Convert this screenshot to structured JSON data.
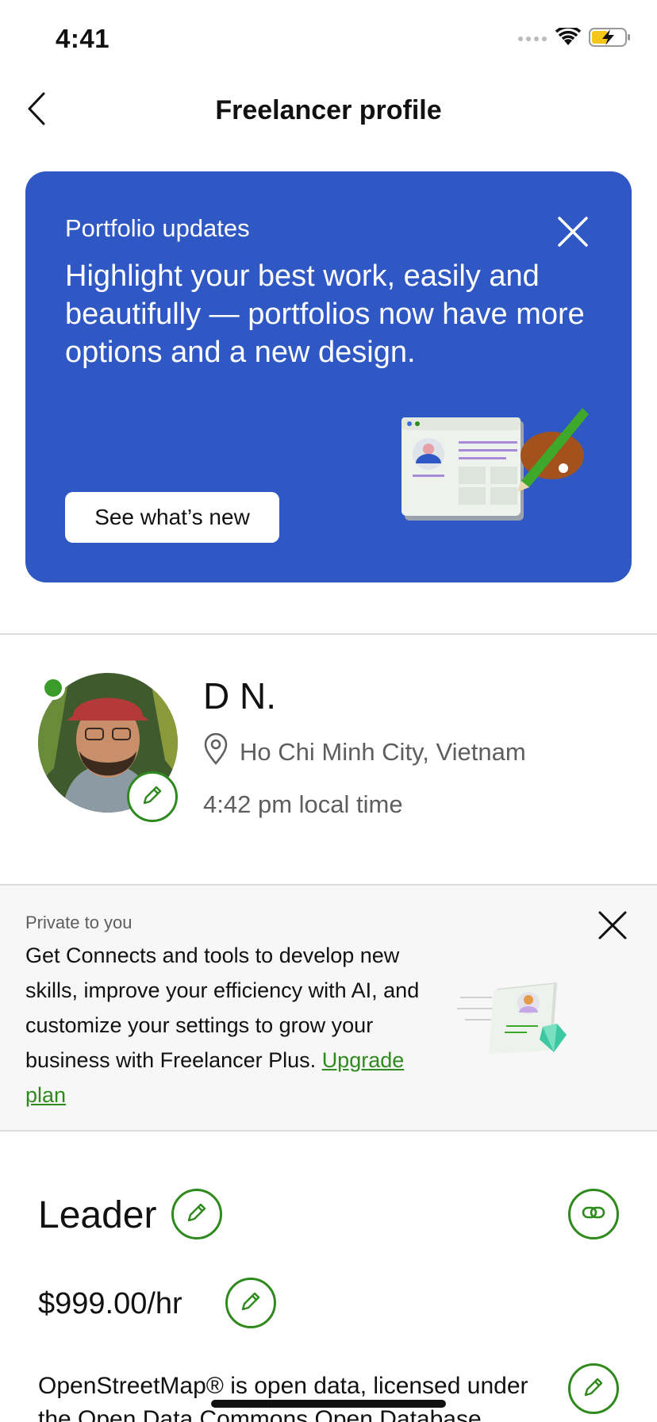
{
  "status_bar": {
    "time": "4:41"
  },
  "nav": {
    "title": "Freelancer profile"
  },
  "promo": {
    "eyebrow": "Portfolio updates",
    "headline": "Highlight your best work, easily and beautifully — portfolios now have more options and a new design.",
    "cta_label": "See what’s new",
    "background_color": "#2f58c5"
  },
  "profile": {
    "name": "D N.",
    "location": "Ho Chi Minh City, Vietnam",
    "local_time": "4:42 pm local time",
    "online": true
  },
  "upsell": {
    "eyebrow": "Private to you",
    "text": "Get Connects and tools to develop new skills, improve your efficiency with AI, and customize your settings to grow your business with Freelancer Plus.",
    "link_label": "Upgrade plan"
  },
  "title_section": {
    "headline": "Leader",
    "rate": "$999.00/hr",
    "overview": "OpenStreetMap® is open data, licensed under the Open Data Commons Open Database"
  },
  "colors": {
    "accent_green": "#2f8a1e",
    "online_green": "#3c9c29"
  },
  "icons": [
    "chevron-left-icon",
    "close-icon",
    "pencil-icon",
    "link-icon",
    "location-pin-icon",
    "wifi-icon",
    "battery-charging-icon",
    "signal-icon"
  ]
}
